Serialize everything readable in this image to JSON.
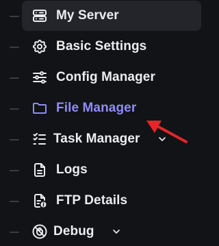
{
  "sidebar": {
    "items": [
      {
        "label": "My Server",
        "icon": "server-icon",
        "state": "selected"
      },
      {
        "label": "Basic Settings",
        "icon": "gear-icon"
      },
      {
        "label": "Config Manager",
        "icon": "sliders-icon"
      },
      {
        "label": "File Manager",
        "icon": "folder-icon",
        "state": "active"
      },
      {
        "label": "Task Manager",
        "icon": "task-list-icon",
        "expandable": true
      },
      {
        "label": "Logs",
        "icon": "document-icon"
      },
      {
        "label": "FTP Details",
        "icon": "document-info-icon"
      },
      {
        "label": "Debug",
        "icon": "bug-off-icon",
        "expandable": true
      }
    ]
  },
  "colors": {
    "background": "#121316",
    "text": "#ededf0",
    "active_text": "#8f8cf7",
    "selected_bg": "#23252b",
    "annotation_arrow": "#e5262a"
  }
}
